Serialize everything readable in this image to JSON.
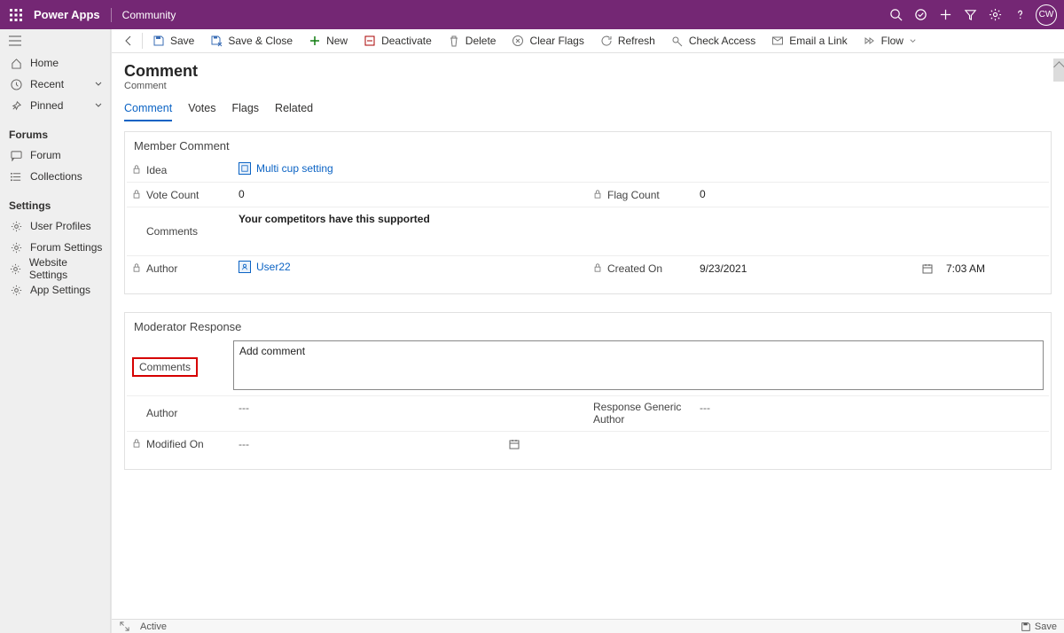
{
  "topbar": {
    "app_name": "Power Apps",
    "env_name": "Community",
    "avatar_initials": "CW"
  },
  "sidebar": {
    "home": "Home",
    "recent": "Recent",
    "pinned": "Pinned",
    "section_forums": "Forums",
    "forum": "Forum",
    "collections": "Collections",
    "section_settings": "Settings",
    "user_profiles": "User Profiles",
    "forum_settings": "Forum Settings",
    "website_settings": "Website Settings",
    "app_settings": "App Settings"
  },
  "cmdbar": {
    "save": "Save",
    "save_close": "Save & Close",
    "new": "New",
    "deactivate": "Deactivate",
    "delete": "Delete",
    "clear_flags": "Clear Flags",
    "refresh": "Refresh",
    "check_access": "Check Access",
    "email_link": "Email a Link",
    "flow": "Flow"
  },
  "header": {
    "title": "Comment",
    "subtitle": "Comment"
  },
  "tabs": {
    "comment": "Comment",
    "votes": "Votes",
    "flags": "Flags",
    "related": "Related"
  },
  "member_comment": {
    "panel_title": "Member Comment",
    "idea_label": "Idea",
    "idea_value": "Multi cup setting",
    "vote_count_label": "Vote Count",
    "vote_count_value": "0",
    "flag_count_label": "Flag Count",
    "flag_count_value": "0",
    "comments_label": "Comments",
    "comments_value": "Your competitors have this supported",
    "author_label": "Author",
    "author_value": "User22",
    "created_on_label": "Created On",
    "created_on_date": "9/23/2021",
    "created_on_time": "7:03 AM"
  },
  "moderator": {
    "panel_title": "Moderator Response",
    "comments_label": "Comments",
    "comments_value": "Add comment",
    "author_label": "Author",
    "author_value": "---",
    "resp_generic_label": "Response Generic Author",
    "resp_generic_value": "---",
    "modified_on_label": "Modified On",
    "modified_on_value": "---"
  },
  "statusbar": {
    "status": "Active",
    "save": "Save"
  }
}
